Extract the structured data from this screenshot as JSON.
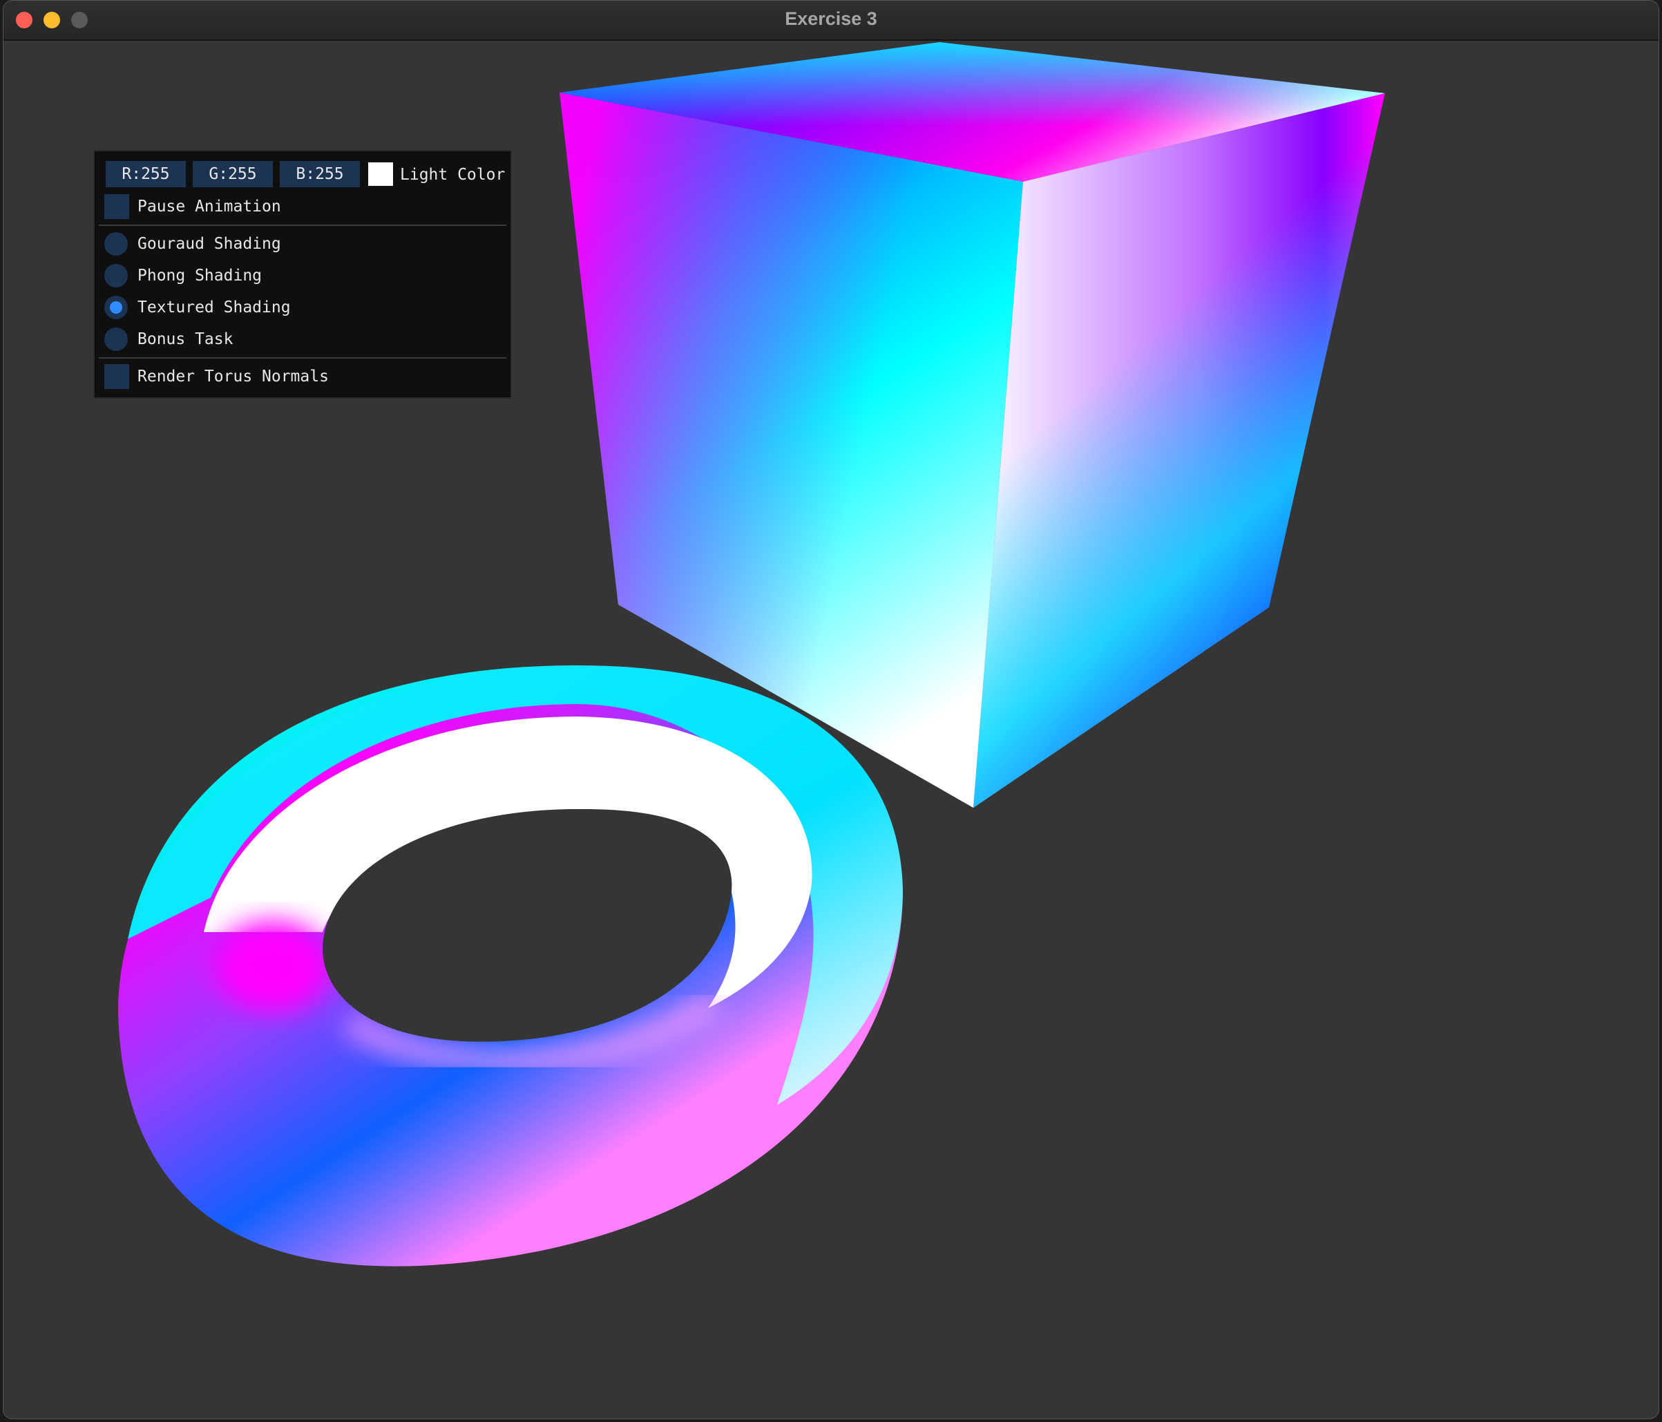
{
  "window": {
    "title": "Exercise 3"
  },
  "controls": {
    "r_field": "R:255",
    "g_field": "G:255",
    "b_field": "B:255",
    "light_color_label": "Light Color",
    "light_color_value": "#ffffff",
    "pause_animation": {
      "label": "Pause Animation",
      "checked": false
    },
    "shading_modes": [
      {
        "label": "Gouraud Shading",
        "selected": false
      },
      {
        "label": "Phong Shading",
        "selected": false
      },
      {
        "label": "Textured Shading",
        "selected": true
      },
      {
        "label": "Bonus Task",
        "selected": false
      }
    ],
    "render_torus_normals": {
      "label": "Render Torus Normals",
      "checked": false
    }
  },
  "colors": {
    "background": "#353535",
    "accent": "#2f8dff",
    "widget": "#1d3352"
  }
}
